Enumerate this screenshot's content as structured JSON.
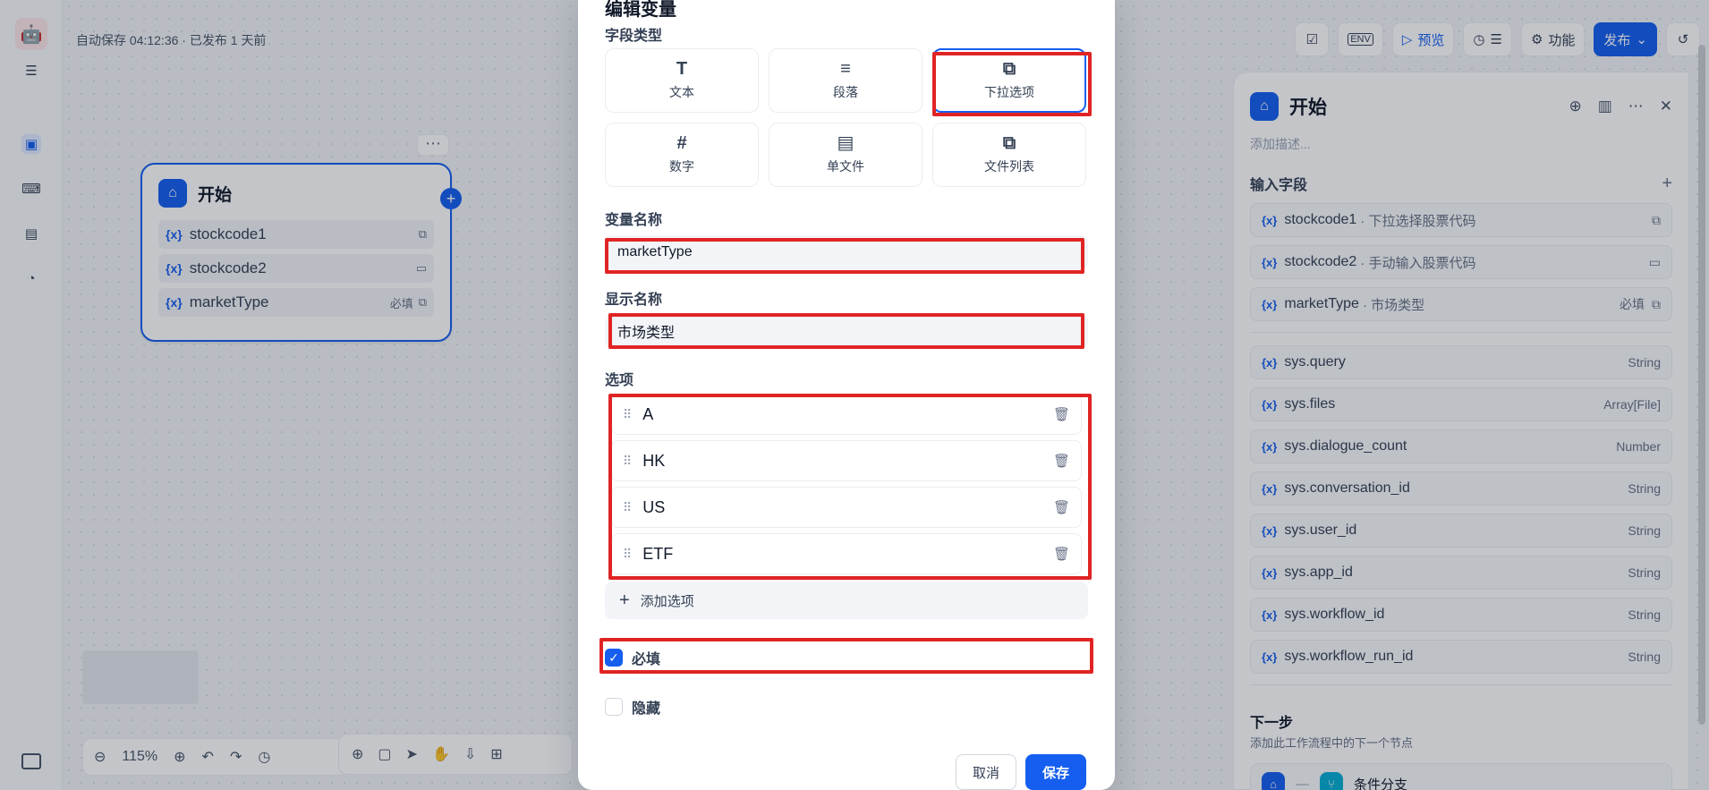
{
  "autosave_text": "自动保存 04:12:36 · 已发布 1 天前",
  "topbar": {
    "preview_label": "预览",
    "features_label": "功能",
    "publish_label": "发布",
    "env_label": "ENV"
  },
  "canvas_node": {
    "title": "开始",
    "vars": [
      {
        "name": "stockcode1",
        "required": ""
      },
      {
        "name": "stockcode2",
        "required": ""
      },
      {
        "name": "marketType",
        "required": "必填"
      }
    ]
  },
  "zoom": {
    "level": "115%"
  },
  "right_panel": {
    "title": "开始",
    "desc_placeholder": "添加描述...",
    "input_section": "输入字段",
    "inputs": [
      {
        "name": "stockcode1",
        "desc": "· 下拉选择股票代码",
        "type": ""
      },
      {
        "name": "stockcode2",
        "desc": "· 手动输入股票代码",
        "type": ""
      },
      {
        "name": "marketType",
        "desc": "· 市场类型",
        "type": "必填"
      }
    ],
    "sys_vars": [
      {
        "name": "sys.query",
        "type": "String"
      },
      {
        "name": "sys.files",
        "type": "Array[File]"
      },
      {
        "name": "sys.dialogue_count",
        "type": "Number"
      },
      {
        "name": "sys.conversation_id",
        "type": "String"
      },
      {
        "name": "sys.user_id",
        "type": "String"
      },
      {
        "name": "sys.app_id",
        "type": "String"
      },
      {
        "name": "sys.workflow_id",
        "type": "String"
      },
      {
        "name": "sys.workflow_run_id",
        "type": "String"
      }
    ],
    "next_title": "下一步",
    "next_desc": "添加此工作流程中的下一个节点",
    "next_node": "条件分支"
  },
  "modal": {
    "title": "编辑变量",
    "field_type_label": "字段类型",
    "types": [
      {
        "label": "文本",
        "icon": "T"
      },
      {
        "label": "段落",
        "icon": "≡"
      },
      {
        "label": "下拉选项",
        "icon": "⧉"
      },
      {
        "label": "数字",
        "icon": "#"
      },
      {
        "label": "单文件",
        "icon": "▤"
      },
      {
        "label": "文件列表",
        "icon": "⧉"
      }
    ],
    "var_name_label": "变量名称",
    "var_name_value": "marketType",
    "display_name_label": "显示名称",
    "display_name_value": "市场类型",
    "options_label": "选项",
    "options": [
      "A",
      "HK",
      "US",
      "ETF"
    ],
    "add_option_label": "添加选项",
    "required_label": "必填",
    "hidden_label": "隐藏",
    "cancel_label": "取消",
    "save_label": "保存"
  },
  "colors": {
    "accent": "#155eef",
    "annotation": "#e02424"
  }
}
